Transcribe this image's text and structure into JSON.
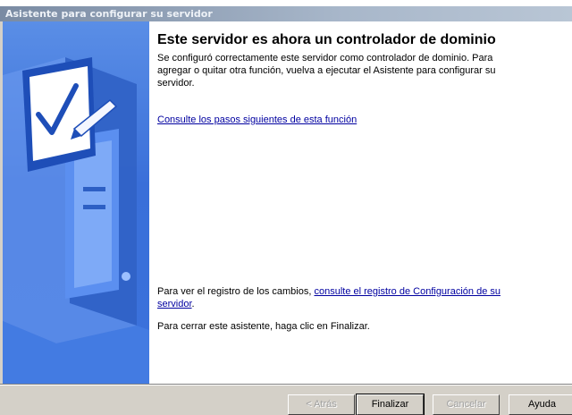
{
  "window": {
    "title": "Asistente para configurar su servidor"
  },
  "main": {
    "heading": "Este servidor es ahora un controlador de dominio",
    "description": "Se configuró correctamente este servidor como controlador de dominio. Para agregar o quitar otra función, vuelva a ejecutar el Asistente para configurar su servidor.",
    "next_steps_link": "Consulte los pasos siguientes de esta función",
    "log_prefix": "Para ver el registro de los cambios, ",
    "log_link": "consulte el registro de Configuración de su servidor",
    "log_suffix": ".",
    "close_text": "Para cerrar este asistente, haga clic en Finalizar."
  },
  "buttons": {
    "back": "< Atrás",
    "finish": "Finalizar",
    "cancel": "Cancelar",
    "help": "Ayuda"
  },
  "colors": {
    "sidebar": "#3a6fd9",
    "link": "#0000a0",
    "titlebar": "#7a8ba3"
  }
}
